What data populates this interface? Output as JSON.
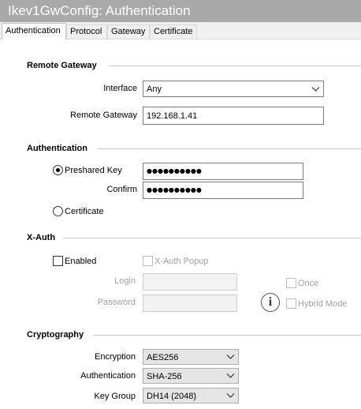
{
  "window": {
    "title": "Ikev1GwConfig: Authentication"
  },
  "tabs": [
    {
      "label": "Authentication",
      "active": true
    },
    {
      "label": "Protocol",
      "active": false
    },
    {
      "label": "Gateway",
      "active": false
    },
    {
      "label": "Certificate",
      "active": false
    }
  ],
  "remote_gateway": {
    "section_title": "Remote Gateway",
    "interface_label": "Interface",
    "interface_value": "Any",
    "gateway_label": "Remote Gateway",
    "gateway_value": "192.168.1.41"
  },
  "authentication": {
    "section_title": "Authentication",
    "preshared_label": "Preshared Key",
    "preshared_selected": true,
    "preshared_value": "●●●●●●●●●●",
    "confirm_label": "Confirm",
    "confirm_value": "●●●●●●●●●●",
    "certificate_label": "Certificate",
    "certificate_selected": false
  },
  "xauth": {
    "section_title": "X-Auth",
    "enabled_label": "Enabled",
    "enabled_checked": false,
    "popup_label": "X-Auth Popup",
    "popup_checked": false,
    "login_label": "Login",
    "login_value": "",
    "password_label": "Password",
    "password_value": "",
    "once_label": "Once",
    "once_checked": false,
    "hybrid_label": "Hybrid Mode",
    "hybrid_checked": false,
    "info_glyph": "i",
    "info_icon": "info-icon"
  },
  "cryptography": {
    "section_title": "Cryptography",
    "encryption_label": "Encryption",
    "encryption_value": "AES256",
    "authentication_label": "Authentication",
    "authentication_value": "SHA-256",
    "keygroup_label": "Key Group",
    "keygroup_value": "DH14 (2048)"
  },
  "colors": {
    "titlebar": "#a9a9a9",
    "disabled_text": "#a0a0a0"
  }
}
